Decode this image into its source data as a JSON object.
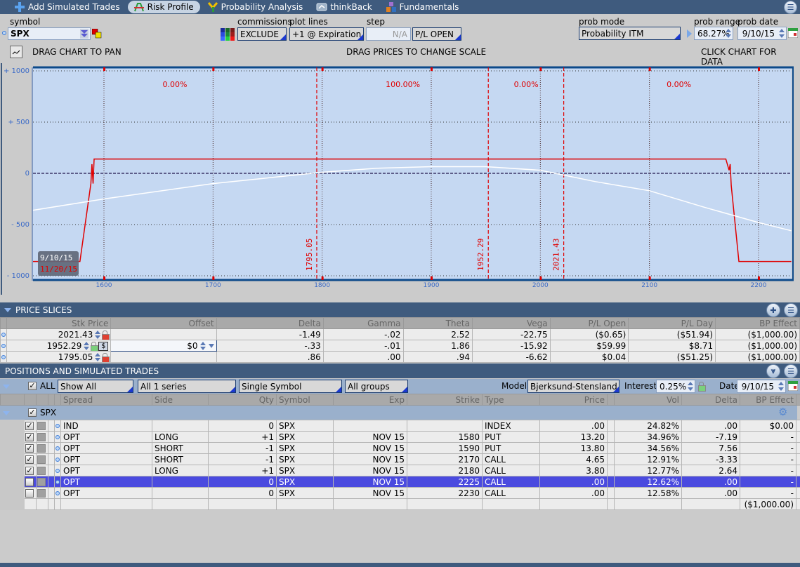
{
  "toolbar": {
    "tabs": [
      {
        "label": "Add Simulated Trades",
        "icon": "plus-icon",
        "active": false
      },
      {
        "label": "Risk Profile",
        "icon": "risk-profile-icon",
        "active": true
      },
      {
        "label": "Probability Analysis",
        "icon": "probability-icon",
        "active": false
      },
      {
        "label": "thinkBack",
        "icon": "thinkback-icon",
        "active": false
      },
      {
        "label": "Fundamentals",
        "icon": "fundamentals-icon",
        "active": false
      }
    ],
    "menu_icon": "list-menu-icon"
  },
  "controls": {
    "symbol_label": "symbol",
    "symbol_value": "SPX",
    "commissions_label": "commissions",
    "commissions_value": "EXCLUDE",
    "plot_lines_label": "plot lines",
    "plot_lines_value": "+1 @ Expiration",
    "step_label": "step",
    "step_value": "N/A",
    "pl_mode_value": "P/L OPEN",
    "prob_mode_label": "prob mode",
    "prob_mode_value": "Probability ITM",
    "prob_range_label": "prob range",
    "prob_range_value": "68.27%",
    "prob_date_label": "prob date",
    "prob_date_value": "9/10/15",
    "hint_pan": "DRAG CHART TO PAN",
    "hint_scale": "DRAG PRICES TO CHANGE SCALE",
    "hint_click": "CLICK CHART FOR DATA"
  },
  "chart_data": {
    "type": "line",
    "title": "",
    "xlabel": "",
    "ylabel": "",
    "xlim": [
      1535,
      2230
    ],
    "ylim": [
      -1000,
      1000
    ],
    "x_ticks": [
      1600,
      1700,
      1800,
      1900,
      2000,
      2100,
      2200
    ],
    "y_ticks": [
      1000,
      500,
      0,
      -500,
      -1000
    ],
    "y_tick_labels": [
      "+ 1000",
      "+ 500",
      "0",
      "- 500",
      "- 1000"
    ],
    "grid": true,
    "series": [
      {
        "name": "11/20/15",
        "color": "#e00000",
        "x": [
          1535,
          1578,
          1588,
          1589,
          1590,
          1591,
          2170,
          2173,
          2174,
          2175,
          2182,
          2230
        ],
        "y": [
          -860,
          -860,
          -100,
          90,
          -100,
          140,
          140,
          30,
          90,
          -120,
          -860,
          -860
        ]
      },
      {
        "name": "9/10/15",
        "color": "#ffffff",
        "x": [
          1535,
          1600,
          1700,
          1800,
          1850,
          1900,
          1950,
          2000,
          2050,
          2100,
          2150,
          2200,
          2230
        ],
        "y": [
          -360,
          -250,
          -100,
          10,
          50,
          65,
          65,
          30,
          -80,
          -170,
          -330,
          -480,
          -560
        ]
      }
    ],
    "price_slices": [
      1795.05,
      1952.29,
      2021.43
    ],
    "prob_labels": [
      {
        "x_center": 1665,
        "text": "0.00%"
      },
      {
        "x_center": 1874,
        "text": "100.00%"
      },
      {
        "x_center": 1987,
        "text": "0.00%"
      },
      {
        "x_center": 2127,
        "text": "0.00%"
      }
    ],
    "legend": {
      "position": "bottom-left",
      "entries": [
        {
          "label": "9/10/15",
          "color": "#ffffff"
        },
        {
          "label": "11/20/15",
          "color": "#e00000"
        }
      ]
    }
  },
  "price_slices": {
    "title": "PRICE SLICES",
    "columns": [
      "Stk Price",
      "Offset",
      "Delta",
      "Gamma",
      "Theta",
      "Vega",
      "P/L Open",
      "P/L Day",
      "BP Effect"
    ],
    "rows": [
      {
        "price": "2021.43",
        "offset": "",
        "delta": "-1.49",
        "gamma": "-.02",
        "theta": "2.52",
        "vega": "-22.75",
        "pl_open": "($0.65)",
        "pl_day": "($51.94)",
        "bp": "($1,000.00)"
      },
      {
        "price": "1952.29",
        "offset": "$0",
        "delta": "-.33",
        "gamma": "-.01",
        "theta": "1.86",
        "vega": "-15.92",
        "pl_open": "$59.99",
        "pl_day": "$8.71",
        "bp": "($1,000.00)"
      },
      {
        "price": "1795.05",
        "offset": "",
        "delta": ".86",
        "gamma": ".00",
        "theta": ".94",
        "vega": "-6.62",
        "pl_open": "$0.04",
        "pl_day": "($51.25)",
        "bp": "($1,000.00)"
      }
    ]
  },
  "positions": {
    "title": "POSITIONS AND SIMULATED TRADES",
    "all_label": "ALL",
    "filter_show": "Show All",
    "filter_series": "All 1 series",
    "filter_symbol": "Single Symbol",
    "filter_groups": "All groups",
    "model_label": "Model",
    "model_value": "Bjerksund-Stensland",
    "interest_label": "Interest",
    "interest_value": "0.25%",
    "date_label": "Date",
    "date_value": "9/10/15",
    "columns": [
      "Spread",
      "Side",
      "Qty",
      "Symbol",
      "Exp",
      "Strike",
      "Type",
      "Price",
      "Vol",
      "Delta",
      "BP Effect"
    ],
    "group_label": "SPX",
    "rows": [
      {
        "checked": true,
        "spread": "IND",
        "side": "",
        "qty": "0",
        "symbol": "SPX",
        "exp": "",
        "strike": "",
        "type": "INDEX",
        "price": ".00",
        "vol": "24.82%",
        "delta": ".00",
        "bp": "$0.00",
        "selected": false
      },
      {
        "checked": true,
        "spread": "OPT",
        "side": "LONG",
        "qty": "+1",
        "symbol": "SPX",
        "exp": "NOV 15",
        "strike": "1580",
        "type": "PUT",
        "price": "13.20",
        "vol": "34.96%",
        "delta": "-7.19",
        "bp": "-",
        "selected": false
      },
      {
        "checked": true,
        "spread": "OPT",
        "side": "SHORT",
        "qty": "-1",
        "symbol": "SPX",
        "exp": "NOV 15",
        "strike": "1590",
        "type": "PUT",
        "price": "13.80",
        "vol": "34.56%",
        "delta": "7.56",
        "bp": "-",
        "selected": false
      },
      {
        "checked": true,
        "spread": "OPT",
        "side": "SHORT",
        "qty": "-1",
        "symbol": "SPX",
        "exp": "NOV 15",
        "strike": "2170",
        "type": "CALL",
        "price": "4.65",
        "vol": "12.91%",
        "delta": "-3.33",
        "bp": "-",
        "selected": false
      },
      {
        "checked": true,
        "spread": "OPT",
        "side": "LONG",
        "qty": "+1",
        "symbol": "SPX",
        "exp": "NOV 15",
        "strike": "2180",
        "type": "CALL",
        "price": "3.80",
        "vol": "12.77%",
        "delta": "2.64",
        "bp": "-",
        "selected": false
      },
      {
        "checked": false,
        "spread": "OPT",
        "side": "",
        "qty": "0",
        "symbol": "SPX",
        "exp": "NOV 15",
        "strike": "2225",
        "type": "CALL",
        "price": ".00",
        "vol": "12.62%",
        "delta": ".00",
        "bp": "-",
        "selected": true
      },
      {
        "checked": false,
        "spread": "OPT",
        "side": "",
        "qty": "0",
        "symbol": "SPX",
        "exp": "NOV 15",
        "strike": "2230",
        "type": "CALL",
        "price": ".00",
        "vol": "12.58%",
        "delta": ".00",
        "bp": "-",
        "selected": false
      }
    ],
    "total_bp": "($1,000.00)"
  }
}
